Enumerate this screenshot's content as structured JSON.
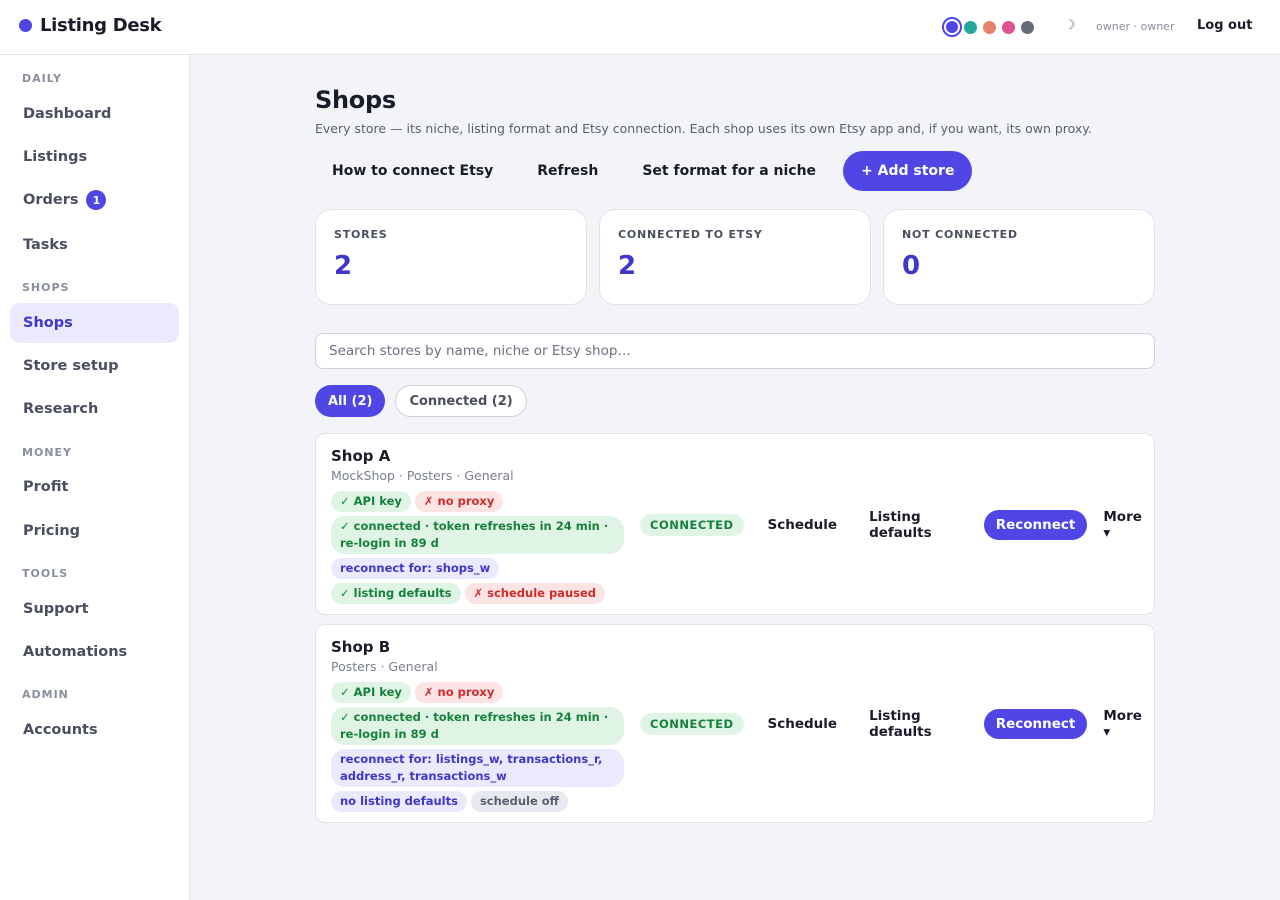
{
  "app": {
    "title": "Listing Desk"
  },
  "topbar": {
    "theme_swatches": [
      "#4f46e5",
      "#22a89b",
      "#e8816a",
      "#e0508f",
      "#646a78"
    ],
    "moon_icon": "☽",
    "user_label": "owner · owner",
    "logout_label": "Log out"
  },
  "sidebar": {
    "sections": [
      "DAILY",
      "SHOPS",
      "MONEY",
      "TOOLS",
      "ADMIN"
    ],
    "items": [
      {
        "label": "Dashboard"
      },
      {
        "label": "Listings"
      },
      {
        "label": "Orders",
        "badge": "1"
      },
      {
        "label": "Tasks"
      },
      {
        "label": "Shops",
        "active": true
      },
      {
        "label": "Store setup"
      },
      {
        "label": "Research"
      },
      {
        "label": "Profit"
      },
      {
        "label": "Pricing"
      },
      {
        "label": "Support"
      },
      {
        "label": "Automations"
      },
      {
        "label": "Accounts"
      }
    ]
  },
  "page": {
    "title": "Shops",
    "subtitle": "Every store — its niche, listing format and Etsy connection. Each shop uses its own Etsy app and, if you want, its own proxy.",
    "actions": [
      "How to connect Etsy",
      "Refresh",
      "Set format for a niche",
      "+ Add store"
    ]
  },
  "stats": [
    {
      "label": "STORES",
      "value": "2"
    },
    {
      "label": "CONNECTED TO ETSY",
      "value": "2"
    },
    {
      "label": "NOT CONNECTED",
      "value": "0"
    }
  ],
  "search": {
    "placeholder": "Search stores by name, niche or Etsy shop…",
    "value": ""
  },
  "filters": [
    {
      "label": "All (2)",
      "active": true
    },
    {
      "label": "Connected (2)",
      "active": false
    }
  ],
  "shops": [
    {
      "name": "Shop A",
      "meta": "MockShop · Posters · General",
      "tags": [
        {
          "text": "✓ API key",
          "color": "green"
        },
        {
          "text": "✗ no proxy",
          "color": "red"
        },
        {
          "text": "✓ connected · token refreshes in 24 min · re-login in 89 d",
          "color": "green"
        },
        {
          "text": "reconnect for: shops_w",
          "color": "purple"
        },
        {
          "text": "✓ listing defaults",
          "color": "green"
        },
        {
          "text": "✗ schedule paused",
          "color": "red"
        }
      ],
      "status": "CONNECTED",
      "actions": {
        "schedule": "Schedule",
        "defaults": "Listing defaults",
        "reconnect": "Reconnect",
        "more": "More ▾"
      }
    },
    {
      "name": "Shop B",
      "meta": "Posters · General",
      "tags": [
        {
          "text": "✓ API key",
          "color": "green"
        },
        {
          "text": "✗ no proxy",
          "color": "red"
        },
        {
          "text": "✓ connected · token refreshes in 24 min · re-login in 89 d",
          "color": "green"
        },
        {
          "text": "reconnect for: listings_w, transactions_r, address_r, transactions_w",
          "color": "purple"
        },
        {
          "text": "no listing defaults",
          "color": "purple"
        },
        {
          "text": "schedule off",
          "color": "gray"
        }
      ],
      "status": "CONNECTED",
      "actions": {
        "schedule": "Schedule",
        "defaults": "Listing defaults",
        "reconnect": "Reconnect",
        "more": "More ▾"
      }
    }
  ]
}
